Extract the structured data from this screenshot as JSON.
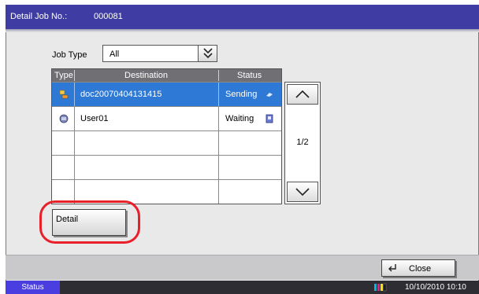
{
  "title": {
    "label": "Detail Job No.:",
    "value": "000081"
  },
  "job_type": {
    "label": "Job Type",
    "selected": "All",
    "dropdown_icon": "double-chevron-down-icon"
  },
  "table": {
    "headers": {
      "type": "Type",
      "destination": "Destination",
      "status": "Status"
    },
    "rows": [
      {
        "type_icon": "send-icon",
        "destination": "doc20070404131415",
        "status": "Sending",
        "status_icon": "sending-icon",
        "selected": true
      },
      {
        "type_icon": "folder-icon",
        "destination": "User01",
        "status": "Waiting",
        "status_icon": "waiting-icon",
        "selected": false
      },
      {
        "destination": "",
        "status": ""
      },
      {
        "destination": "",
        "status": ""
      },
      {
        "destination": "",
        "status": ""
      }
    ]
  },
  "pager": {
    "page": "1/2",
    "up_icon": "chevron-up-icon",
    "down_icon": "chevron-down-icon"
  },
  "detail_button": {
    "label": "Detail"
  },
  "close_button": {
    "label": "Close",
    "icon": "return-arrow-icon"
  },
  "status_bar": {
    "status_label": "Status",
    "datetime": "10/10/2010  10:10",
    "toner_icon": "toner-icon"
  },
  "colors": {
    "title_bar": "#3f3da4",
    "selected_row": "#2e79d6",
    "highlight": "#e8202a",
    "status_button": "#4a3ee0"
  }
}
